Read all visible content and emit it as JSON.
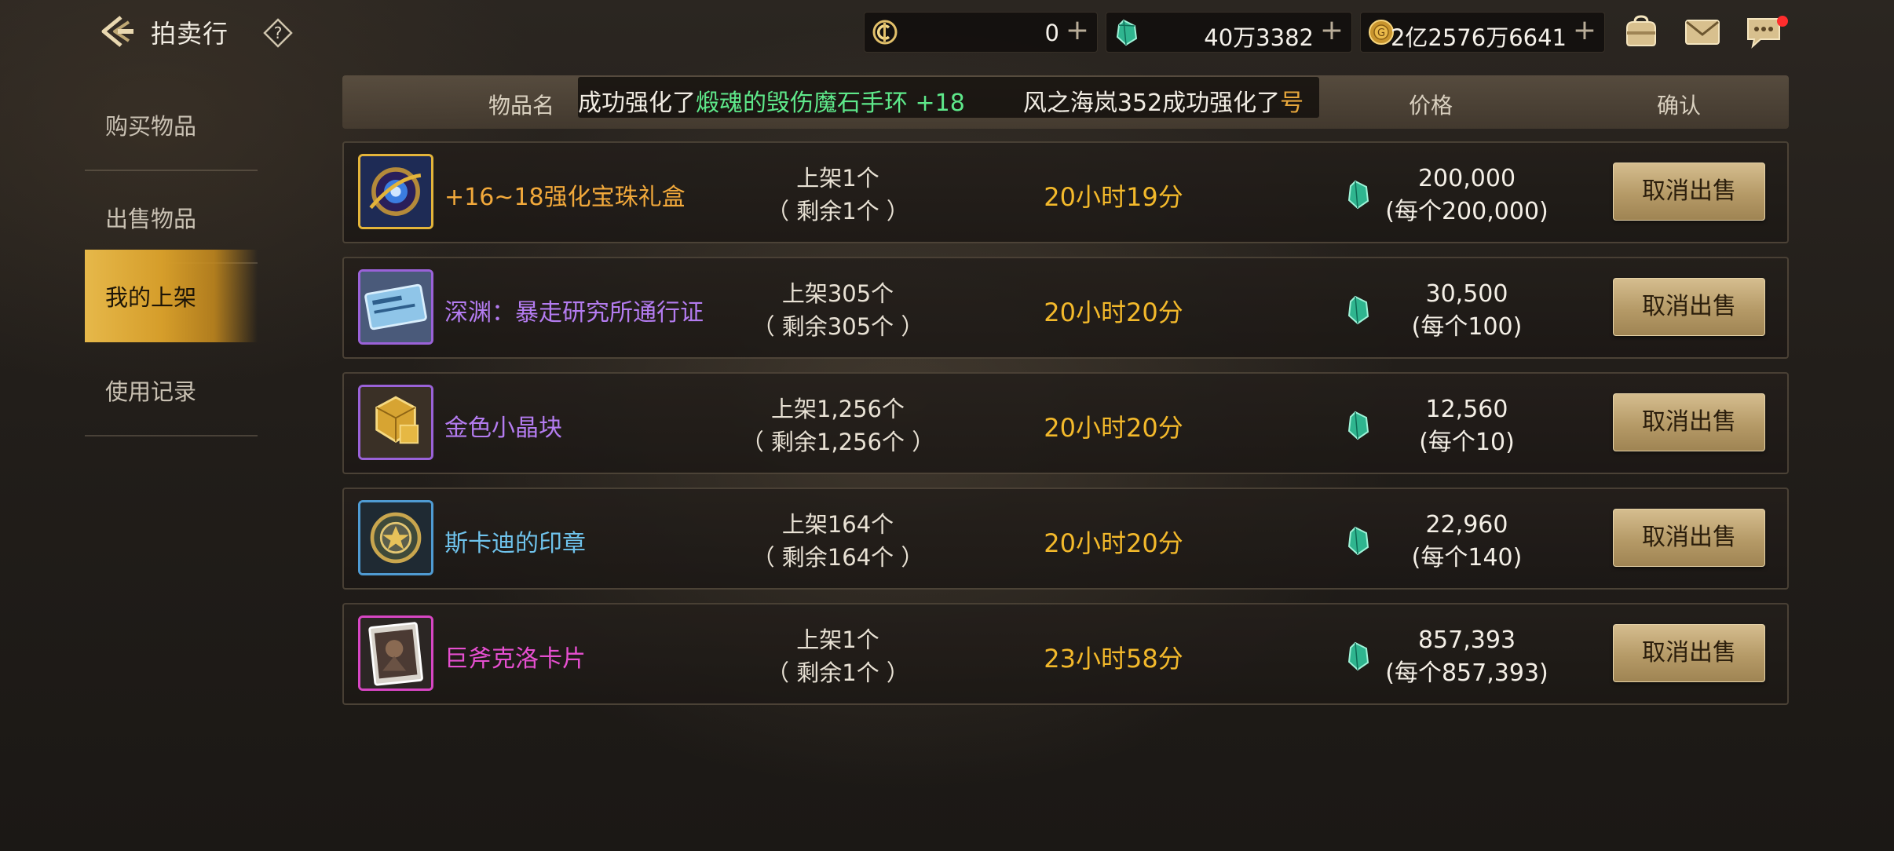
{
  "header": {
    "title": "拍卖行",
    "currencies": [
      {
        "icon": "c-coin-icon",
        "value": "0"
      },
      {
        "icon": "green-gem-icon",
        "value": "40万3382"
      },
      {
        "icon": "gold-coin-icon",
        "value": "2亿2576万6641"
      }
    ]
  },
  "sidebar": {
    "items": [
      {
        "label": "购买物品",
        "active": false
      },
      {
        "label": "出售物品",
        "active": false
      },
      {
        "label": "我的上架",
        "active": true
      },
      {
        "label": "使用记录",
        "active": false
      }
    ]
  },
  "table": {
    "headers": {
      "name": "物品名",
      "price": "价格",
      "confirm": "确认"
    },
    "ticker": {
      "seg1_prefix": "成功强化了",
      "seg1_item": "煅魂的毁伤魔石手环 +18",
      "seg2_prefix": "风之海岚352成功强化了",
      "seg2_item": "号"
    },
    "rows": [
      {
        "name": "+16~18强化宝珠礼盒",
        "name_color": "#f2a93b",
        "qty_listed": "上架1个",
        "qty_remaining": "（ 剩余1个 ）",
        "time_left": "20小时19分",
        "price_total": "200,000",
        "price_each": "(每个200,000)",
        "button": "取消出售",
        "icon": "gem-orb-box-icon",
        "frame_color": "#e3b43a"
      },
      {
        "name": "深渊：暴走研究所通行证",
        "name_color": "#b47cf0",
        "qty_listed": "上架305个",
        "qty_remaining": "（ 剩余305个 ）",
        "time_left": "20小时20分",
        "price_total": "30,500",
        "price_each": "(每个100)",
        "button": "取消出售",
        "icon": "pass-ticket-icon",
        "frame_color": "#9a62d8"
      },
      {
        "name": "金色小晶块",
        "name_color": "#b47cf0",
        "qty_listed": "上架1,256个",
        "qty_remaining": "（ 剩余1,256个 ）",
        "time_left": "20小时20分",
        "price_total": "12,560",
        "price_each": "(每个10)",
        "button": "取消出售",
        "icon": "gold-crystal-icon",
        "frame_color": "#9a62d8"
      },
      {
        "name": "斯卡迪的印章",
        "name_color": "#6fc3ec",
        "qty_listed": "上架164个",
        "qty_remaining": "（ 剩余164个 ）",
        "time_left": "20小时20分",
        "price_total": "22,960",
        "price_each": "(每个140)",
        "button": "取消出售",
        "icon": "skadi-seal-icon",
        "frame_color": "#4f9bd3"
      },
      {
        "name": "巨斧克洛卡片",
        "name_color": "#e64fd0",
        "qty_listed": "上架1个",
        "qty_remaining": "（ 剩余1个 ）",
        "time_left": "23小时58分",
        "price_total": "857,393",
        "price_each": "(每个857,393)",
        "button": "取消出售",
        "icon": "card-icon",
        "frame_color": "#d746c3"
      }
    ]
  }
}
